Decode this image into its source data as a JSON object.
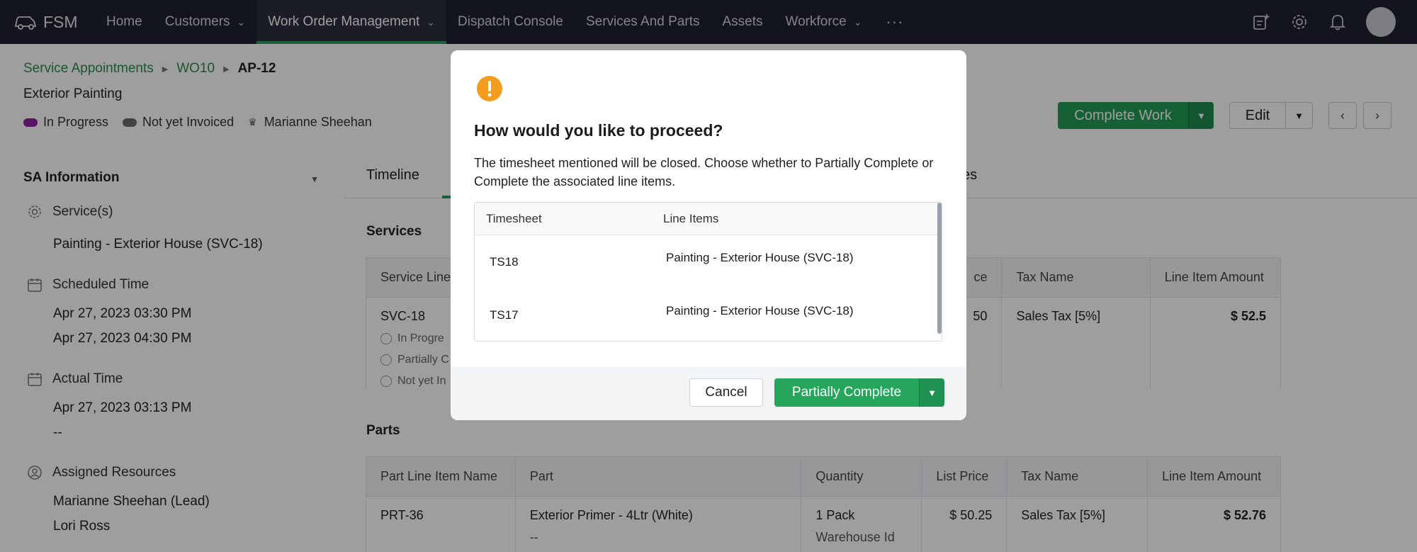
{
  "nav": {
    "brand": "FSM",
    "items": [
      {
        "label": "Home",
        "caret": false,
        "active": false
      },
      {
        "label": "Customers",
        "caret": true,
        "active": false
      },
      {
        "label": "Work Order Management",
        "caret": true,
        "active": true
      },
      {
        "label": "Dispatch Console",
        "caret": false,
        "active": false
      },
      {
        "label": "Services And Parts",
        "caret": false,
        "active": false
      },
      {
        "label": "Assets",
        "caret": false,
        "active": false
      },
      {
        "label": "Workforce",
        "caret": true,
        "active": false
      }
    ],
    "more": "···",
    "right_icons": [
      "add-note-icon",
      "gear-icon",
      "bell-icon",
      "avatar"
    ]
  },
  "header": {
    "breadcrumb": [
      "Service Appointments",
      "WO10",
      "AP-12"
    ],
    "subtitle": "Exterior Painting",
    "tags": [
      {
        "label": "In Progress",
        "color": "#8e1fa0"
      },
      {
        "label": "Not yet Invoiced",
        "color": "#6b6b6b"
      },
      {
        "label": "Marianne Sheehan",
        "icon": "crown-icon"
      }
    ],
    "complete_work": "Complete Work",
    "edit": "Edit"
  },
  "sa_info": {
    "title": "SA Information",
    "services_label": "Service(s)",
    "services_value": "Painting - Exterior House (SVC-18)",
    "scheduled_label": "Scheduled Time",
    "scheduled_start": "Apr 27, 2023 03:30 PM",
    "scheduled_end": "Apr 27, 2023 04:30 PM",
    "actual_label": "Actual Time",
    "actual_start": "Apr 27, 2023 03:13 PM",
    "actual_end": "--",
    "resources_label": "Assigned Resources",
    "resource_1": "Marianne Sheehan (Lead)",
    "resource_2": "Lori Ross"
  },
  "main": {
    "tab_timeline": "Timeline",
    "tab_partial": "es",
    "services_label": "Services",
    "services_table": {
      "headers": [
        "Service Line",
        "ce",
        "Tax Name",
        "Line Item Amount"
      ],
      "row": {
        "name": "SVC-18",
        "status_1": "In Progre",
        "status_2": "Partially C",
        "status_3": "Not yet In",
        "price_partial": "50",
        "tax": "Sales Tax [5%]",
        "amount": "$ 52.5"
      }
    },
    "parts_label": "Parts",
    "parts_table": {
      "headers": [
        "Part Line Item Name",
        "Part",
        "Quantity",
        "List Price",
        "Tax Name",
        "Line Item Amount"
      ],
      "row": {
        "name": "PRT-36",
        "part": "Exterior Primer - 4Ltr (White)",
        "part_sub": "--",
        "quantity": "1 Pack",
        "quantity_sub": "Warehouse Id",
        "list_price": "$ 50.25",
        "tax": "Sales Tax [5%]",
        "amount": "$ 52.76"
      }
    }
  },
  "modal": {
    "icon": "warning-icon",
    "icon_color": "#f29d1f",
    "title": "How would you like to proceed?",
    "message": "The timesheet mentioned will be closed. Choose whether to Partially Complete or Complete the associated line items.",
    "columns": [
      "Timesheet",
      "Line Items"
    ],
    "rows": [
      {
        "timesheet": "TS18",
        "line_items": "Painting - Exterior House (SVC-18)"
      },
      {
        "timesheet": "TS17",
        "line_items": "Painting - Exterior House (SVC-18)"
      }
    ],
    "cancel": "Cancel",
    "confirm": "Partially Complete"
  }
}
